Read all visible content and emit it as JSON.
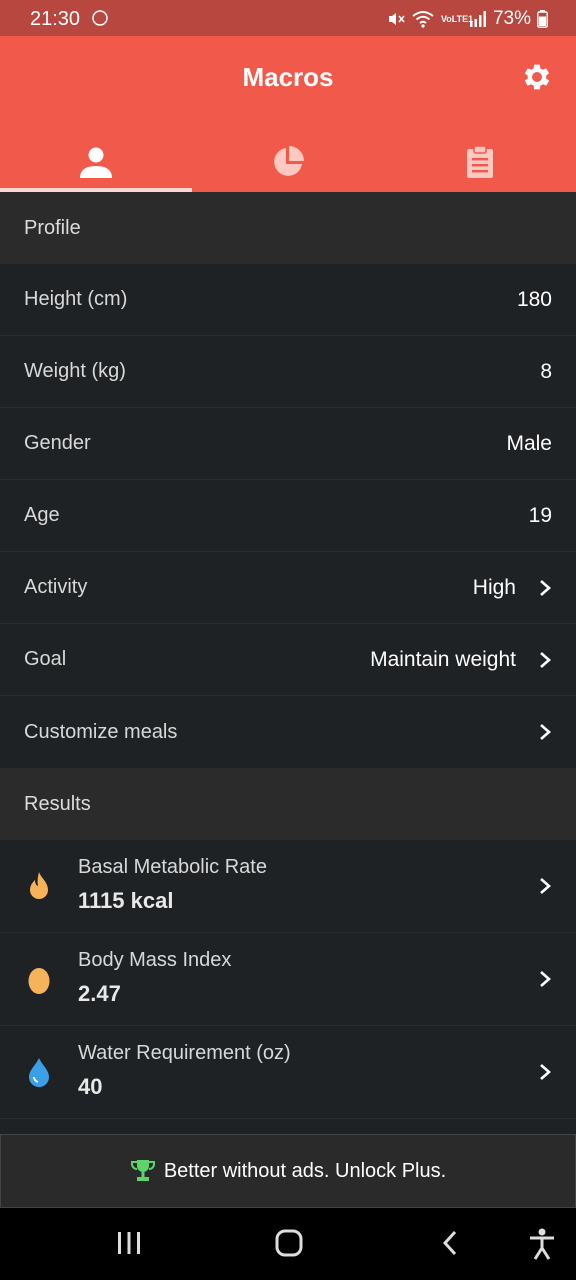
{
  "status_bar": {
    "time": "21:30",
    "network_label": "VoLTE1",
    "battery": "73%"
  },
  "app": {
    "title": "Macros",
    "accent_color": "#f15a4b"
  },
  "tabs": [
    {
      "icon": "person-icon",
      "active": true
    },
    {
      "icon": "pie-chart-icon",
      "active": false
    },
    {
      "icon": "clipboard-icon",
      "active": false
    }
  ],
  "profile": {
    "header": "Profile",
    "rows": [
      {
        "label": "Height (cm)",
        "value": "180"
      },
      {
        "label": "Weight (kg)",
        "value": "8"
      },
      {
        "label": "Gender",
        "value": "Male"
      },
      {
        "label": "Age",
        "value": "19"
      },
      {
        "label": "Activity",
        "value": "High"
      },
      {
        "label": "Goal",
        "value": "Maintain weight"
      },
      {
        "label": "Customize meals",
        "value": ""
      }
    ]
  },
  "results": {
    "header": "Results",
    "items": [
      {
        "title": "Basal Metabolic Rate",
        "value": "1115 kcal",
        "icon": "flame-icon"
      },
      {
        "title": "Body Mass Index",
        "value": "2.47",
        "icon": "egg-icon"
      },
      {
        "title": "Water Requirement (oz)",
        "value": "40",
        "icon": "water-drop-icon"
      }
    ]
  },
  "banner": {
    "text": "Better without ads. Unlock Plus.",
    "icon": "trophy-icon"
  }
}
